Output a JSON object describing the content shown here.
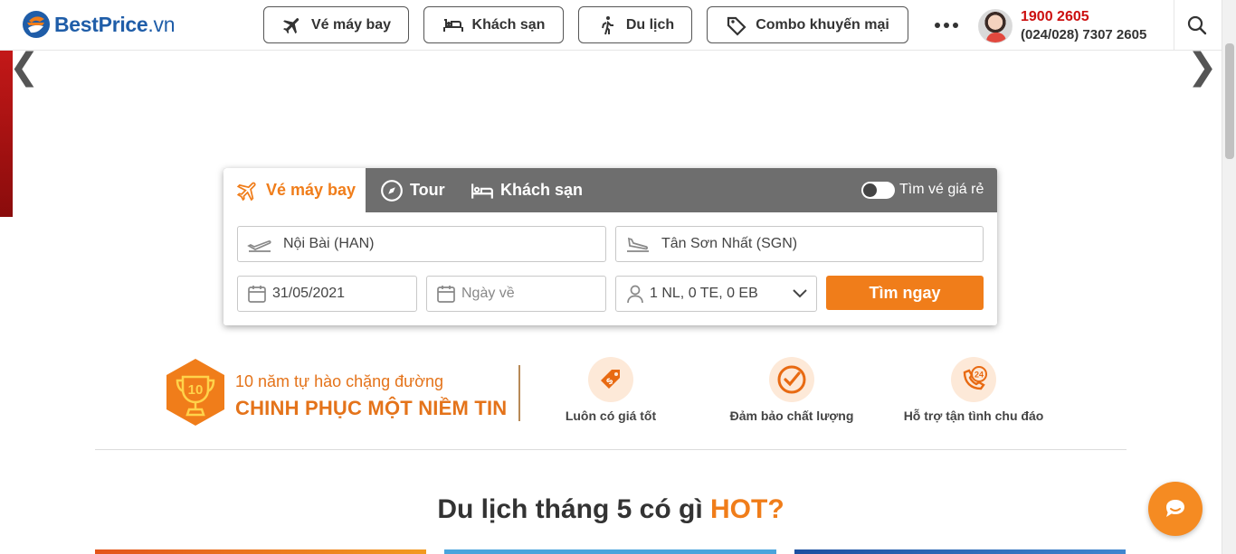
{
  "header": {
    "logo_text": "BestPrice",
    "logo_suffix": ".vn",
    "nav": [
      {
        "label": "Vé máy bay",
        "icon": "plane-icon"
      },
      {
        "label": "Khách sạn",
        "icon": "bed-icon"
      },
      {
        "label": "Du lịch",
        "icon": "hiker-icon"
      },
      {
        "label": "Combo khuyến mại",
        "icon": "tag-icon"
      }
    ],
    "more_icon": "more-dots-icon",
    "hotline_primary": "1900 2605",
    "hotline_secondary": "(024/028) 7307 2605",
    "search_icon": "search-icon"
  },
  "banner": {
    "prev_glyph": "❮",
    "next_glyph": "❯"
  },
  "search_box": {
    "tabs": [
      {
        "label": "Vé máy bay",
        "active": true,
        "icon": "plane-icon"
      },
      {
        "label": "Tour",
        "active": false,
        "icon": "compass-icon"
      },
      {
        "label": "Khách sạn",
        "active": false,
        "icon": "bed-icon"
      }
    ],
    "cheap_toggle_label": "Tìm vé giá rẻ",
    "cheap_toggle_on": false,
    "from_value": "Nội Bài (HAN)",
    "to_value": "Tân Sơn Nhất (SGN)",
    "depart_value": "31/05/2021",
    "return_placeholder": "Ngày về",
    "passengers_value": "1 NL, 0 TE, 0 EB",
    "search_button": "Tìm ngay"
  },
  "proud": {
    "line1": "10 năm tự hào chặng đường",
    "line2": "CHINH PHỤC MỘT NIỀM TIN",
    "trophy_number": "10"
  },
  "features": [
    {
      "label": "Luôn có giá tốt",
      "icon": "price-tag-icon"
    },
    {
      "label": "Đảm bảo chất lượng",
      "icon": "check-circle-icon"
    },
    {
      "label": "Hỗ trợ tận tình chu đáo",
      "icon": "phone-24-icon"
    }
  ],
  "hot_section": {
    "title_prefix": "Du lịch tháng 5 có gì ",
    "title_hot": "HOT?"
  },
  "colors": {
    "accent": "#f07d1a",
    "brand_blue": "#1f5da8",
    "hotline_red": "#cc1010",
    "tabbar_gray": "#6e6e6e"
  }
}
